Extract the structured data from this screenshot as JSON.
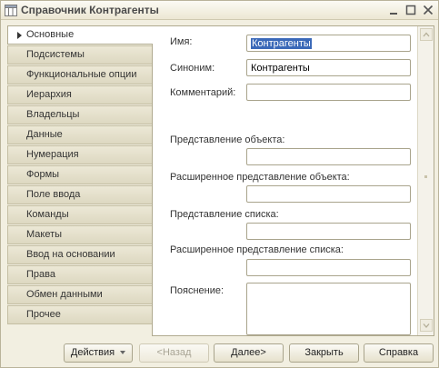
{
  "window": {
    "title": "Справочник Контрагенты"
  },
  "tabs": [
    {
      "label": "Основные",
      "active": true
    },
    {
      "label": "Подсистемы"
    },
    {
      "label": "Функциональные опции"
    },
    {
      "label": "Иерархия"
    },
    {
      "label": "Владельцы"
    },
    {
      "label": "Данные"
    },
    {
      "label": "Нумерация"
    },
    {
      "label": "Формы"
    },
    {
      "label": "Поле ввода"
    },
    {
      "label": "Команды"
    },
    {
      "label": "Макеты"
    },
    {
      "label": "Ввод на основании"
    },
    {
      "label": "Права"
    },
    {
      "label": "Обмен данными"
    },
    {
      "label": "Прочее"
    }
  ],
  "form": {
    "name_label": "Имя:",
    "name_value": "Контрагенты",
    "synonym_label": "Синоним:",
    "synonym_value": "Контрагенты",
    "comment_label": "Комментарий:",
    "comment_value": "",
    "object_repr_label": "Представление объекта:",
    "object_repr_value": "",
    "ext_object_repr_label": "Расширенное представление объекта:",
    "ext_object_repr_value": "",
    "list_repr_label": "Представление списка:",
    "list_repr_value": "",
    "ext_list_repr_label": "Расширенное представление списка:",
    "ext_list_repr_value": "",
    "explanation_label": "Пояснение:",
    "explanation_value": ""
  },
  "buttons": {
    "actions": "Действия",
    "back": "<Назад",
    "next": "Далее>",
    "close": "Закрыть",
    "help": "Справка"
  },
  "colors": {
    "window_bg": "#f2efe1",
    "selection": "#3b69b8"
  }
}
